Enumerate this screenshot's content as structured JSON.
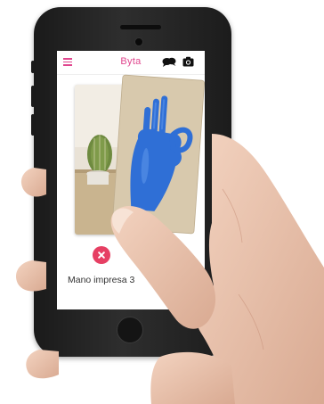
{
  "app": {
    "title": "Byta"
  },
  "header": {
    "menu_icon": "hamburger-menu-icon",
    "chat_icon": "chat-bubbles-icon",
    "camera_icon": "camera-icon"
  },
  "cards": {
    "back_card": "cactus-photo",
    "front_card": "blue-hand-ok-gesture-photo",
    "caption": "Mano impresa 3"
  },
  "actions": {
    "dislike_icon": "close-icon"
  },
  "colors": {
    "accent": "#e0468e",
    "dislike": "#e63f63",
    "phone_body": "#1f1f1f",
    "hand_blue": "#2f6fd6"
  }
}
